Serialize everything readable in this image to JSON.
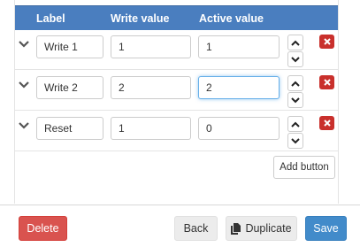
{
  "table": {
    "headers": {
      "label": "Label",
      "write_value": "Write value",
      "active_value": "Active value"
    },
    "rows": [
      {
        "label": "Write 1",
        "write_value": "1",
        "active_value": "1"
      },
      {
        "label": "Write 2",
        "write_value": "2",
        "active_value": "2"
      },
      {
        "label": "Reset",
        "write_value": "1",
        "active_value": "0"
      }
    ],
    "add_button_label": "Add button"
  },
  "footer": {
    "delete_label": "Delete",
    "back_label": "Back",
    "duplicate_label": "Duplicate",
    "save_label": "Save"
  },
  "colors": {
    "header_bg": "#4a7ebf",
    "danger": "#d9534f",
    "primary": "#428bca",
    "focus": "#66afe9"
  },
  "icons": {
    "expand": "chevron-down-icon",
    "move_up": "chevron-up-icon",
    "move_down": "chevron-down-icon",
    "remove": "close-icon",
    "duplicate": "copy-icon"
  }
}
